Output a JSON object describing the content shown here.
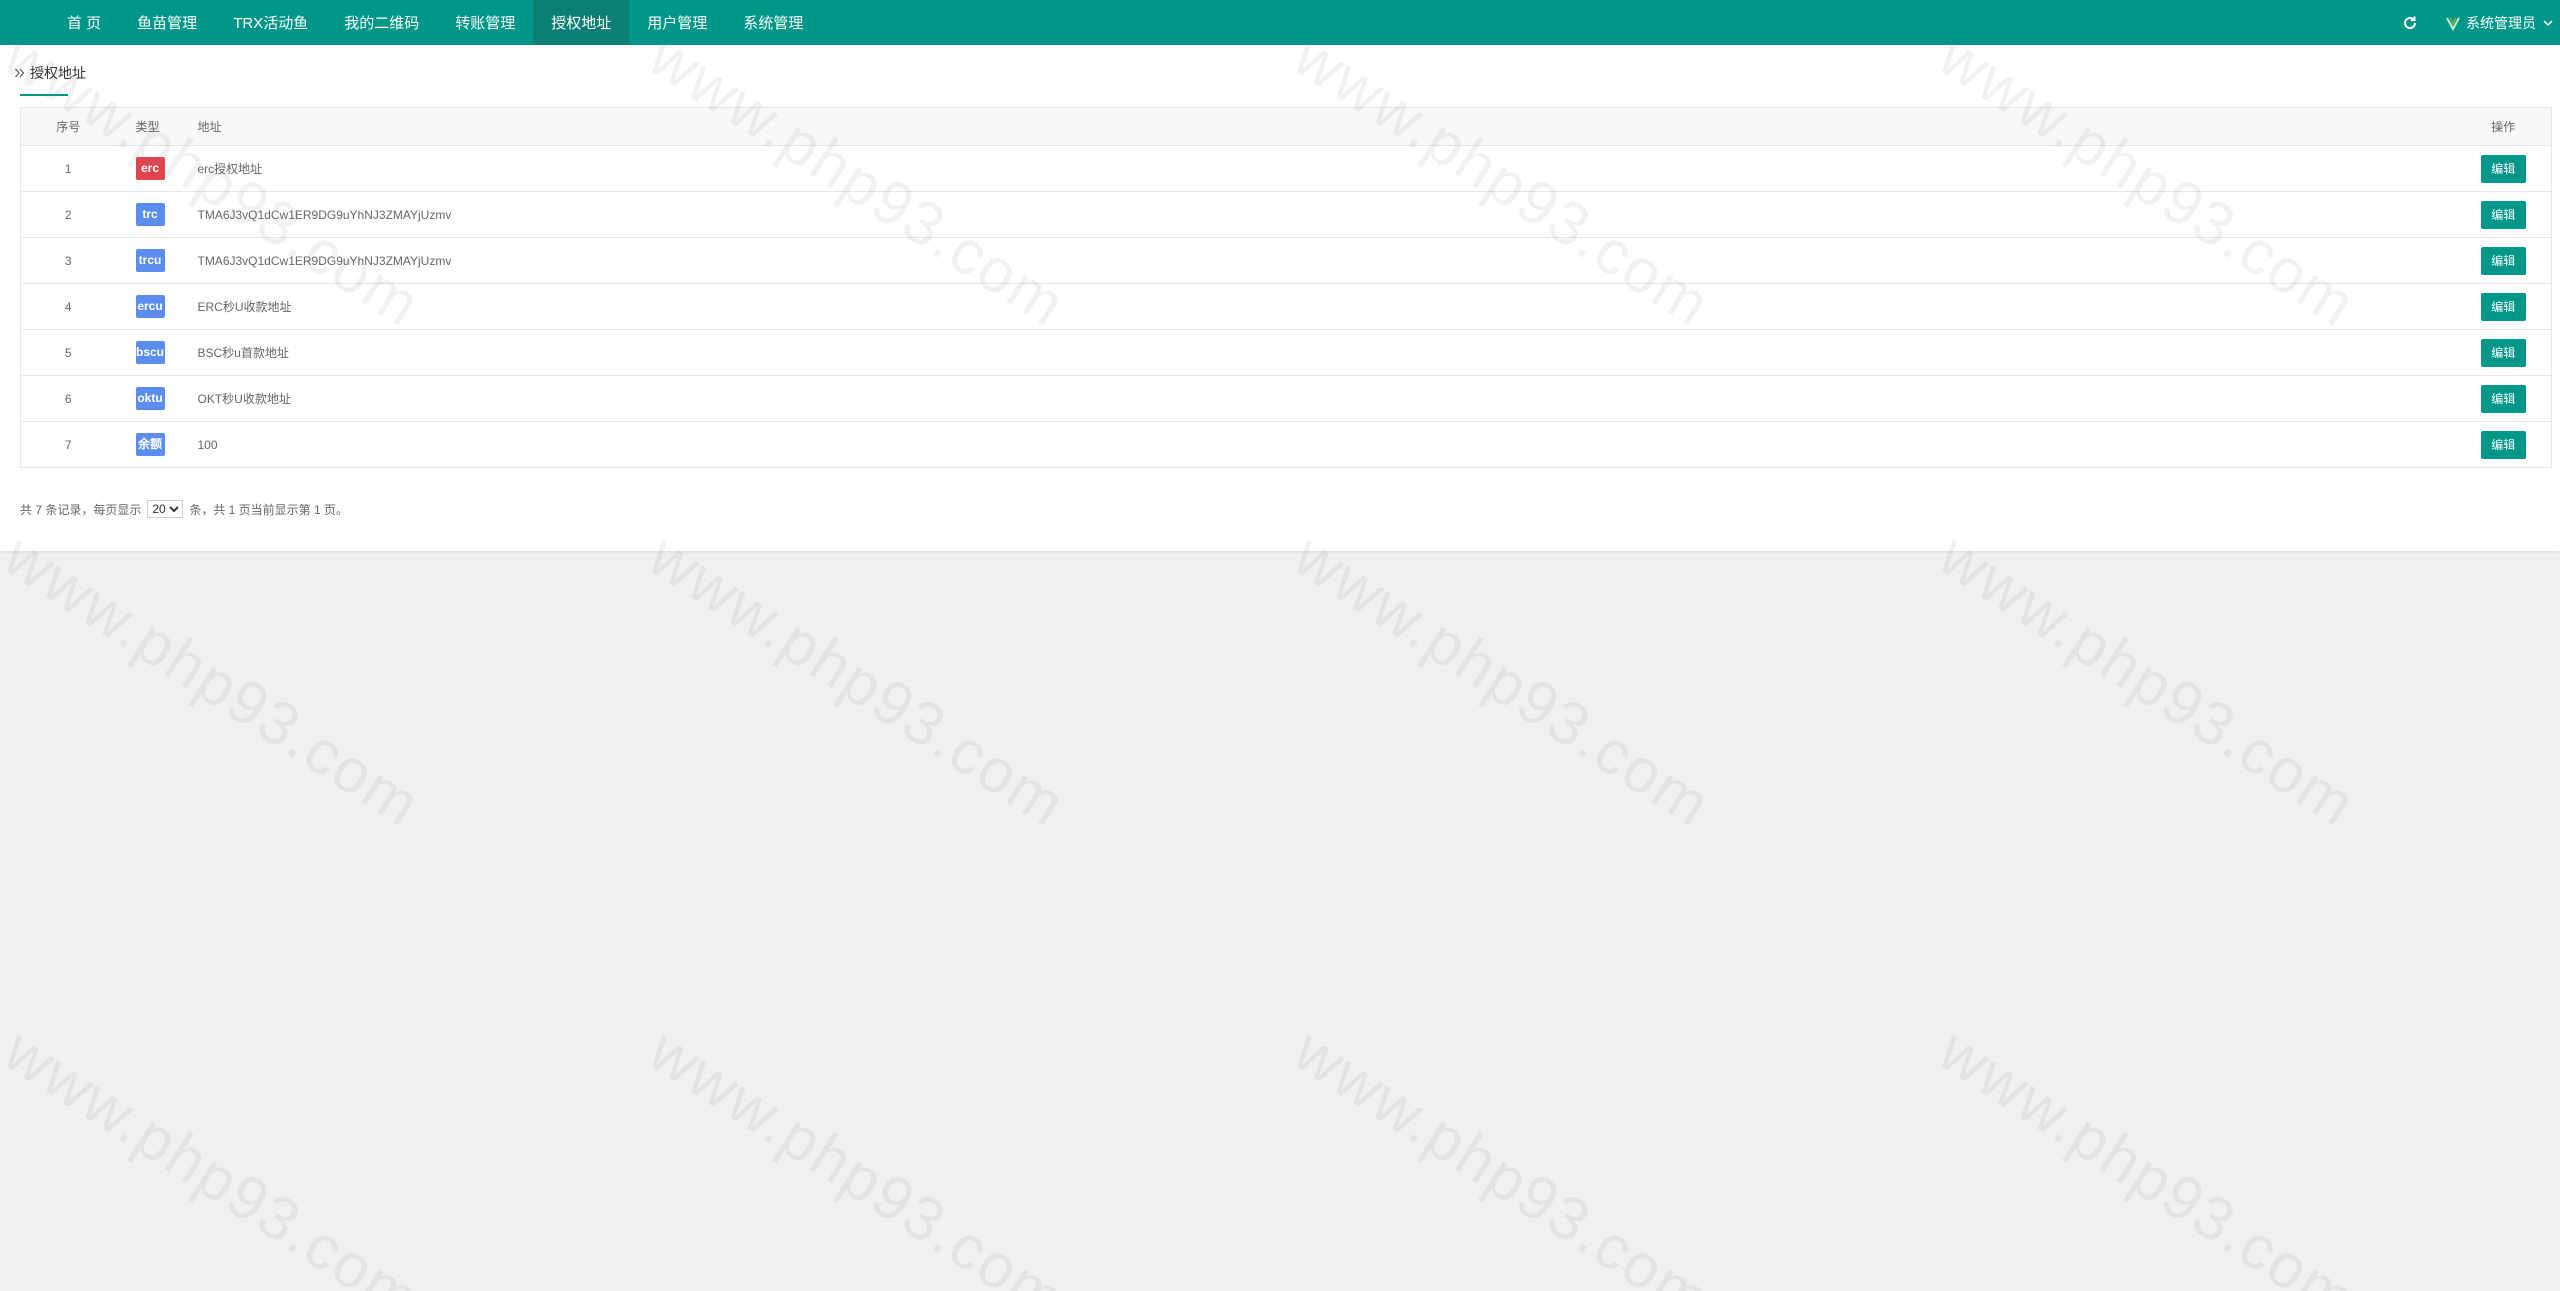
{
  "nav": {
    "items": [
      {
        "label": "首 页",
        "active": false
      },
      {
        "label": "鱼苗管理",
        "active": false
      },
      {
        "label": "TRX活动鱼",
        "active": false
      },
      {
        "label": "我的二维码",
        "active": false
      },
      {
        "label": "转账管理",
        "active": false
      },
      {
        "label": "授权地址",
        "active": true
      },
      {
        "label": "用户管理",
        "active": false
      },
      {
        "label": "系统管理",
        "active": false
      }
    ],
    "user_label": "系统管理员"
  },
  "breadcrumb": {
    "title": "授权地址"
  },
  "table": {
    "headers": {
      "index": "序号",
      "type": "类型",
      "address": "地址",
      "operation": "操作"
    },
    "rows": [
      {
        "index": "1",
        "type": "erc",
        "type_color": "#e0454e",
        "address": "erc授权地址",
        "edit": "编辑"
      },
      {
        "index": "2",
        "type": "trc",
        "type_color": "#5b8dee",
        "address": "TMA6J3vQ1dCw1ER9DG9uYhNJ3ZMAYjUzmv",
        "edit": "编辑"
      },
      {
        "index": "3",
        "type": "trcu",
        "type_color": "#5b8dee",
        "address": "TMA6J3vQ1dCw1ER9DG9uYhNJ3ZMAYjUzmv",
        "edit": "编辑"
      },
      {
        "index": "4",
        "type": "ercu",
        "type_color": "#5b8dee",
        "address": "ERC秒U收款地址",
        "edit": "编辑"
      },
      {
        "index": "5",
        "type": "bscu",
        "type_color": "#5b8dee",
        "address": "BSC秒u首款地址",
        "edit": "编辑"
      },
      {
        "index": "6",
        "type": "oktu",
        "type_color": "#5b8dee",
        "address": "OKT秒U收款地址",
        "edit": "编辑"
      },
      {
        "index": "7",
        "type": "余额",
        "type_color": "#5b8dee",
        "address": "100",
        "edit": "编辑"
      }
    ]
  },
  "pager": {
    "prefix": "共 7 条记录，每页显示",
    "page_size": "20",
    "suffix": "条，共 1 页当前显示第 1 页。"
  },
  "colors": {
    "primary": "#009688",
    "nav_active": "#0c7f74",
    "tag_red": "#e0454e",
    "tag_blue": "#5b8dee"
  },
  "watermark": "www.php93.com",
  "icons": {
    "refresh": "refresh-icon",
    "avatar": "user-v-icon",
    "chevron": "chevron-down-icon",
    "breadcrumb": "double-chevron-right-icon"
  }
}
